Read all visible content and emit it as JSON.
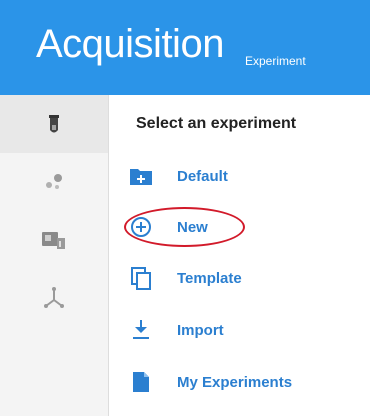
{
  "header": {
    "title": "Acquisition",
    "subtitle": "Experiment",
    "background": "#2b94e8"
  },
  "rail": {
    "items": [
      {
        "name": "test-tube-icon",
        "active": true
      },
      {
        "name": "dots-icon",
        "active": false
      },
      {
        "name": "device-icon",
        "active": false
      },
      {
        "name": "network-icon",
        "active": false
      }
    ]
  },
  "main": {
    "section_title": "Select an experiment",
    "items": [
      {
        "label": "Default",
        "icon": "folder-plus-icon"
      },
      {
        "label": "New",
        "icon": "plus-circle-icon"
      },
      {
        "label": "Template",
        "icon": "copy-icon"
      },
      {
        "label": "Import",
        "icon": "download-icon"
      },
      {
        "label": "My Experiments",
        "icon": "file-icon"
      }
    ],
    "accent": "#2b7fd0"
  },
  "annotation": {
    "color": "#d21a2a",
    "target": "New"
  }
}
